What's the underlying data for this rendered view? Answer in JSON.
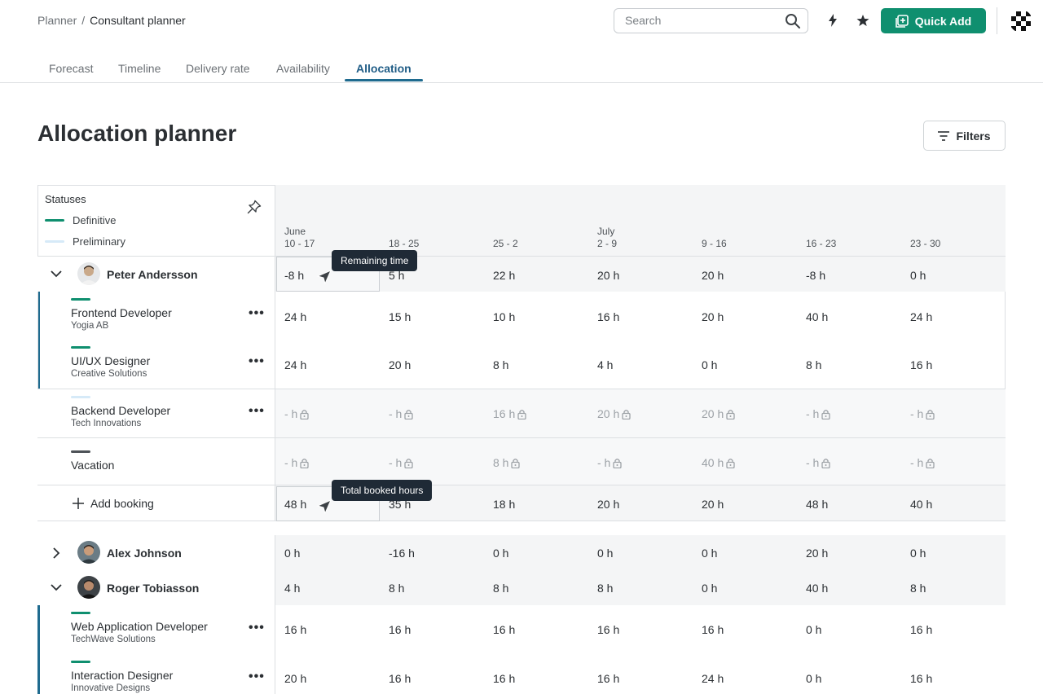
{
  "breadcrumb": {
    "parent": "Planner",
    "separator": "/",
    "current": "Consultant planner"
  },
  "search": {
    "placeholder": "Search"
  },
  "header": {
    "quick_add_label": "Quick Add",
    "colors": {
      "accent": "#0f8f6f",
      "tab_active": "#1f5c86"
    }
  },
  "tabs": [
    {
      "label": "Forecast"
    },
    {
      "label": "Timeline"
    },
    {
      "label": "Delivery rate"
    },
    {
      "label": "Availability"
    },
    {
      "label": "Allocation",
      "active": true
    }
  ],
  "page": {
    "title": "Allocation planner",
    "filters_label": "Filters"
  },
  "legend": {
    "title": "Statuses",
    "definitive": {
      "label": "Definitive",
      "color": "#0f8f6f"
    },
    "preliminary": {
      "label": "Preliminary",
      "color": "#d6eaf8"
    }
  },
  "columns": [
    {
      "month": "June",
      "range": "10 - 17"
    },
    {
      "month": "",
      "range": "18 - 25"
    },
    {
      "month": "",
      "range": "25 - 2"
    },
    {
      "month": "July",
      "range": "2 - 9"
    },
    {
      "month": "",
      "range": "9 - 16"
    },
    {
      "month": "",
      "range": "16 - 23"
    },
    {
      "month": "",
      "range": "23 - 30"
    }
  ],
  "people": {
    "peter": {
      "name": "Peter Andersson",
      "remaining": [
        "-8 h",
        "5 h",
        "22 h",
        "20 h",
        "20 h",
        "-8 h",
        "0 h"
      ],
      "bookings": [
        {
          "title": "Frontend Developer",
          "client": "Yogia AB",
          "values": [
            "24 h",
            "15 h",
            "10 h",
            "16 h",
            "20 h",
            "40 h",
            "24 h"
          ]
        },
        {
          "title": "UI/UX Designer",
          "client": "Creative Solutions",
          "values": [
            "24 h",
            "20 h",
            "8 h",
            "4 h",
            "0 h",
            "8 h",
            "16 h"
          ]
        },
        {
          "title": "Backend Developer",
          "client": "Tech Innovations",
          "values": [
            "- h",
            "- h",
            "16 h",
            "20 h",
            "20 h",
            "- h",
            "- h"
          ]
        },
        {
          "title": "Vacation",
          "client": "",
          "values": [
            "- h",
            "- h",
            "8 h",
            "- h",
            "40 h",
            "- h",
            "- h"
          ]
        }
      ],
      "add_booking_label": "Add booking",
      "total": [
        "48 h",
        "35 h",
        "18 h",
        "20 h",
        "20 h",
        "48 h",
        "40 h"
      ]
    },
    "alex": {
      "name": "Alex Johnson",
      "remaining": [
        "0 h",
        "-16 h",
        "0 h",
        "0 h",
        "0 h",
        "20 h",
        "0 h"
      ]
    },
    "roger": {
      "name": "Roger Tobiasson",
      "remaining": [
        "4 h",
        "8 h",
        "8 h",
        "8 h",
        "0 h",
        "40 h",
        "8 h"
      ],
      "bookings": [
        {
          "title": "Web Application Developer",
          "client": "TechWave Solutions",
          "values": [
            "16 h",
            "16 h",
            "16 h",
            "16 h",
            "16 h",
            "0 h",
            "16 h"
          ]
        },
        {
          "title": "Interaction Designer",
          "client": "Innovative Designs",
          "values": [
            "20 h",
            "16 h",
            "16 h",
            "16 h",
            "24 h",
            "0 h",
            "16 h"
          ]
        }
      ]
    }
  },
  "tooltips": {
    "remaining": "Remaining time",
    "total": "Total booked hours"
  },
  "icons": {
    "search": "search-icon",
    "bolt": "lightning-icon",
    "star": "star-icon",
    "pin": "pin-icon",
    "lock": "lock-icon",
    "filter": "filter-icon",
    "plus": "plus-icon"
  }
}
